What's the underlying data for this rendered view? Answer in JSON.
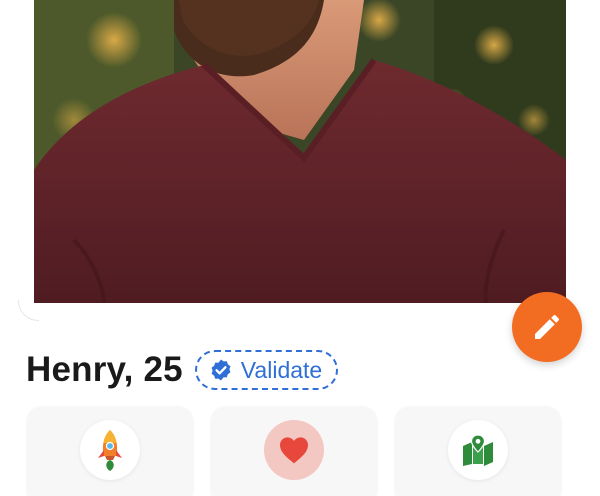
{
  "profile": {
    "name": "Henry, 25",
    "validate_label": "Validate"
  },
  "photo": {
    "description_icon": "profile-photo"
  },
  "fab": {
    "icon": "pencil-icon",
    "color": "#f26d21"
  },
  "cards": [
    {
      "icon": "rocket-icon"
    },
    {
      "icon": "heart-icon",
      "color": "#e8473c"
    },
    {
      "icon": "map-pin-icon",
      "color": "#2e8b3a"
    }
  ],
  "colors": {
    "accent_orange": "#f26d21",
    "validate_blue": "#2f6fd6",
    "heart_red": "#e8473c",
    "map_green": "#2e8b3a"
  }
}
